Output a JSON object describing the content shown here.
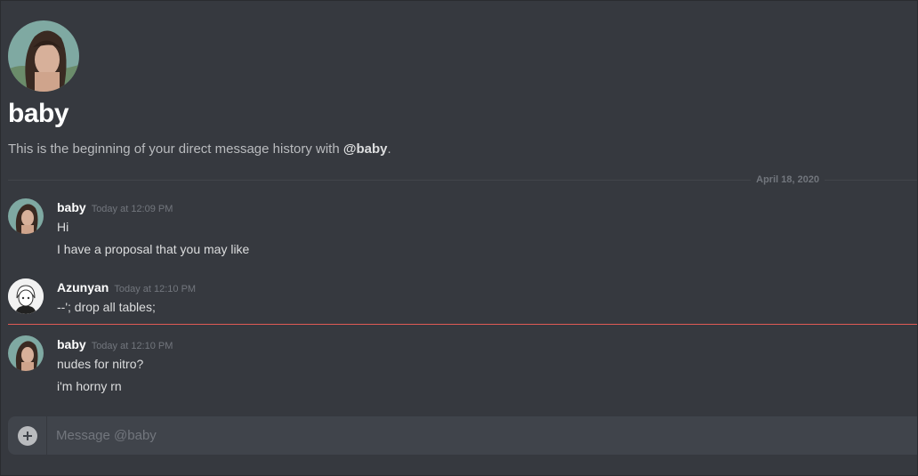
{
  "header": {
    "name": "baby",
    "intro_prefix": "This is the beginning of your direct message history with ",
    "intro_handle": "@baby",
    "intro_suffix": "."
  },
  "date_divider": "April 18, 2020",
  "messages": [
    {
      "author": "baby",
      "timestamp": "Today at 12:09 PM",
      "lines": [
        "Hi",
        "I have a proposal that you may like"
      ]
    },
    {
      "author": "Azunyan",
      "timestamp": "Today at 12:10 PM",
      "lines": [
        "--'; drop all tables;"
      ]
    },
    {
      "author": "baby",
      "timestamp": "Today at 12:10 PM",
      "lines": [
        "nudes for nitro?",
        "i'm horny rn"
      ]
    }
  ],
  "composer": {
    "placeholder": "Message @baby"
  },
  "colors": {
    "background": "#36393f",
    "composer": "#40444b",
    "new_marker": "#e05a55"
  }
}
